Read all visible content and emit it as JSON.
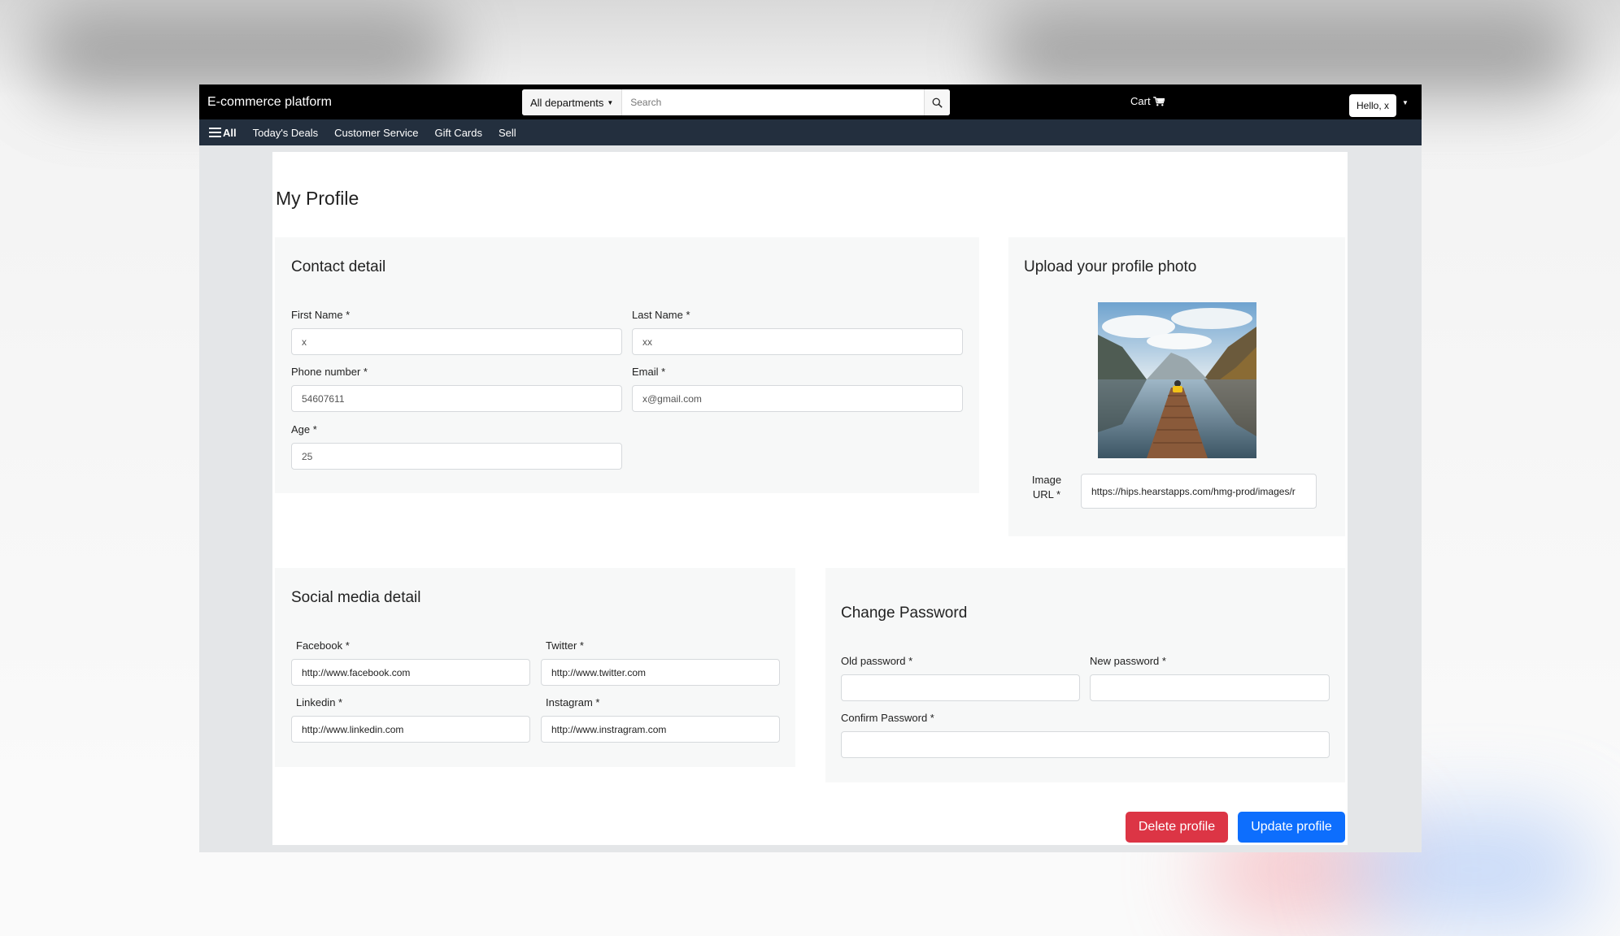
{
  "header": {
    "brand": "E-commerce platform",
    "department_label": "All departments",
    "search_placeholder": "Search",
    "cart_label": "Cart",
    "greeting": "Hello, x"
  },
  "nav": {
    "all_label": "All",
    "items": [
      "Today's Deals",
      "Customer Service",
      "Gift Cards",
      "Sell"
    ]
  },
  "page": {
    "title": "My Profile"
  },
  "contact": {
    "title": "Contact detail",
    "first_name": {
      "label": "First Name *",
      "value": "x"
    },
    "last_name": {
      "label": "Last Name *",
      "value": "xx"
    },
    "phone": {
      "label": "Phone number *",
      "value": "54607611"
    },
    "email": {
      "label": "Email *",
      "value": "x@gmail.com"
    },
    "age": {
      "label": "Age *",
      "value": "25"
    }
  },
  "photo": {
    "title": "Upload your profile photo",
    "image_url_label": "Image URL *",
    "image_url_value": "https://hips.hearstapps.com/hmg-prod/images/r"
  },
  "social": {
    "title": "Social media detail",
    "facebook": {
      "label": "Facebook *",
      "value": "http://www.facebook.com"
    },
    "twitter": {
      "label": "Twitter *",
      "value": "http://www.twitter.com"
    },
    "linkedin": {
      "label": "Linkedin *",
      "value": "http://www.linkedin.com"
    },
    "instagram": {
      "label": "Instagram *",
      "value": "http://www.instragram.com"
    }
  },
  "password": {
    "title": "Change Password",
    "old": {
      "label": "Old password *",
      "value": ""
    },
    "new": {
      "label": "New password *",
      "value": ""
    },
    "confirm": {
      "label": "Confirm Password *",
      "value": ""
    }
  },
  "actions": {
    "delete_label": "Delete profile",
    "update_label": "Update profile"
  },
  "colors": {
    "danger": "#dc3545",
    "primary": "#0d6efd",
    "topbar": "#000000",
    "navbar": "#232f3e"
  },
  "icons": {
    "search": "search-icon",
    "cart": "cart-icon",
    "menu": "hamburger-icon"
  }
}
